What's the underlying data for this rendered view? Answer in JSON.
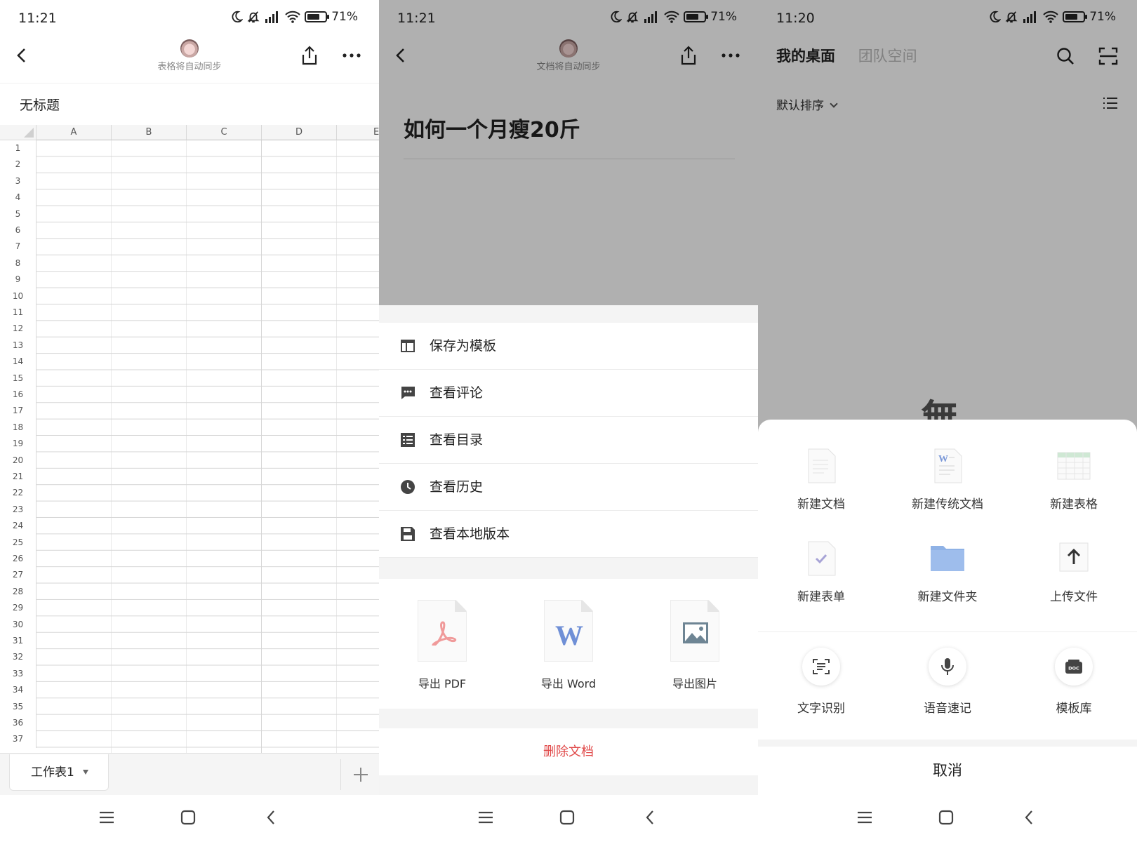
{
  "panel1": {
    "status": {
      "time": "11:21",
      "battery": "71%"
    },
    "subtitle": "表格将自动同步",
    "sheet_title": "无标题",
    "columns": [
      "A",
      "B",
      "C",
      "D",
      "E"
    ],
    "rows": [
      "1",
      "2",
      "3",
      "4",
      "5",
      "6",
      "7",
      "8",
      "9",
      "10",
      "11",
      "12",
      "13",
      "14",
      "15",
      "16",
      "17",
      "18",
      "19",
      "20",
      "21",
      "22",
      "23",
      "24",
      "25",
      "26",
      "27",
      "28",
      "29",
      "30",
      "31",
      "32",
      "33",
      "34",
      "35",
      "36",
      "37"
    ],
    "sheet_tab": "工作表1"
  },
  "panel2": {
    "status": {
      "time": "11:21",
      "battery": "71%"
    },
    "subtitle": "文档将自动同步",
    "doc_title": "如何一个月瘦20斤",
    "menu": [
      "保存为模板",
      "查看评论",
      "查看目录",
      "查看历史",
      "查看本地版本"
    ],
    "exports": [
      "导出 PDF",
      "导出 Word",
      "导出图片"
    ],
    "delete": "删除文档"
  },
  "panel3": {
    "status": {
      "time": "11:20",
      "battery": "71%"
    },
    "tab_active": "我的桌面",
    "tab_inactive": "团队空间",
    "sort": "默认排序",
    "empty_glyph": "無",
    "create": [
      "新建文档",
      "新建传统文档",
      "新建表格",
      "新建表单",
      "新建文件夹",
      "上传文件"
    ],
    "tools": [
      "文字识别",
      "语音速记",
      "模板库"
    ],
    "cancel": "取消"
  },
  "colors": {
    "accent": "#e04848",
    "folder": "#8fb2e6",
    "overlay": "rgba(0,0,0,0.31)"
  }
}
